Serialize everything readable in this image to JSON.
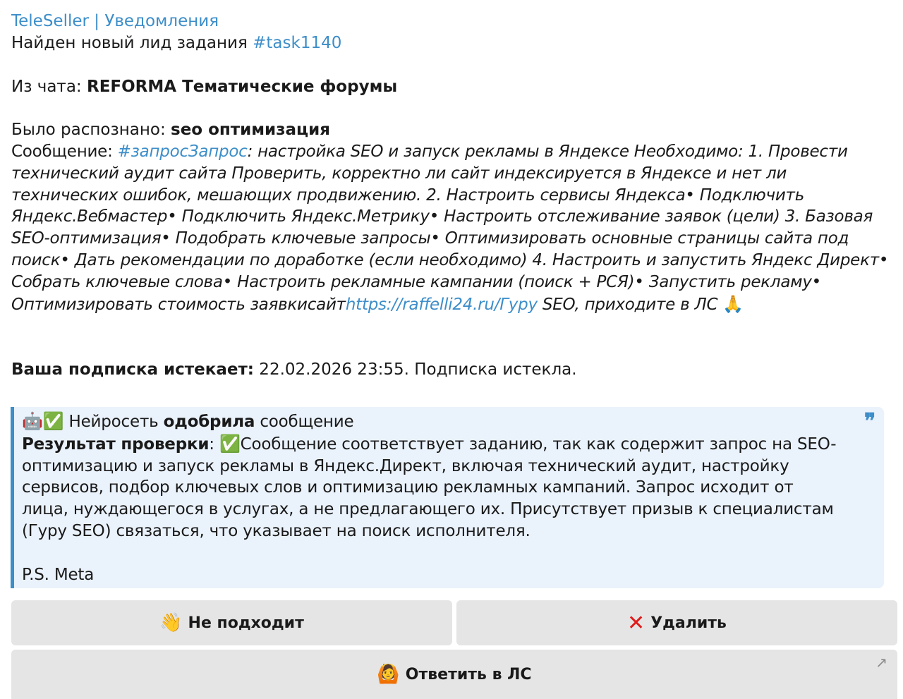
{
  "sender": "TeleSeller | Уведомления",
  "lead_text": "Найден новый лид задания ",
  "task_tag": "#task1140",
  "chat_label": "Из чата: ",
  "chat_name": "REFORMA Тематические форумы",
  "recognized_label": "Было распознано: ",
  "recognized_value": "seo оптимизация",
  "message_label": "Сообщение: ",
  "message_tag": "#запросЗапрос",
  "message_body": ": настройка SEO и запуск рекламы в Яндексе Необходимо: 1. Провести технический аудит сайта Проверить, корректно ли сайт индексируется в Яндексе и нет ли технических ошибок, мешающих продвижению. 2. Настроить сервисы Яндекса• Подключить Яндекс.Вебмастер• Подключить Яндекс.Метрику• Настроить отслеживание заявок (цели) 3. Базовая SEO-оптимизация• Подобрать ключевые запросы• Оптимизировать основные страницы сайта под поиск• Дать рекомендации по доработке (если необходимо) 4. Настроить и запустить Яндекс Директ• Собрать ключевые слова• Настроить рекламные кампании (поиск + РСЯ)• Запустить рекламу• Оптимизировать стоимость заявкисайт",
  "message_link": "https://raffelli24.ru/Гуру",
  "message_tail": " SEO, приходите в ЛС ",
  "message_tail_emoji": "🙏",
  "subscription_label": "Ваша подписка истекает:",
  "subscription_value": " 22.02.2026 23:55. Подписка истекла.",
  "quote": {
    "emoji_robot": "🤖",
    "emoji_check": "✅",
    "line1_pre": " Нейросеть ",
    "line1_bold": "одобрила",
    "line1_post": " сообщение",
    "result_label": "Результат проверки",
    "result_colon": ": ",
    "result_text": "Сообщение соответствует заданию, так как содержит запрос на SEO-оптимизацию и запуск рекламы в Яндекс.Директ, включая технический аудит, настройку сервисов, подбор ключевых слов и оптимизацию рекламных кампаний. Запрос исходит от лица, нуждающегося в услугах, а не предлагающего их. Присутствует призыв к специалистам (Гуру SEO) связаться, что указывает на поиск исполнителя.",
    "ps": "P.S. Meta",
    "mark": "❞"
  },
  "buttons": {
    "not_fit": {
      "icon": "👋",
      "label": "Не подходит"
    },
    "delete": {
      "icon": "✕",
      "label": "Удалить"
    },
    "reply": {
      "icon": "🙆",
      "label": "Ответить в ЛС",
      "corner_icon": "↗"
    }
  }
}
